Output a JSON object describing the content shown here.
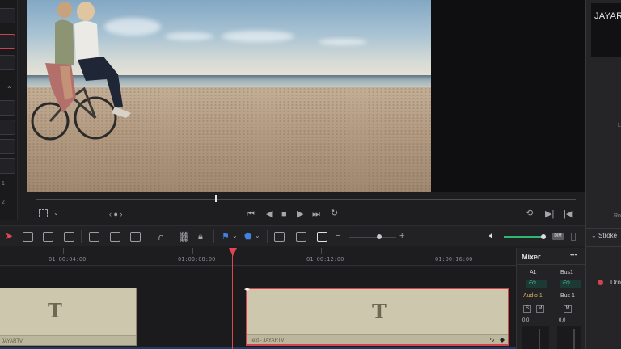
{
  "viewer": {
    "right_title": "JAYAR"
  },
  "transport": {
    "nav_label": "‹ ● ›"
  },
  "timeline": {
    "timecodes": [
      "01:00:04:00",
      "01:00:08:00",
      "01:00:12:00",
      "01:00:16:00"
    ],
    "clips": [
      {
        "glyph": "T",
        "name": "JAYARTV"
      },
      {
        "glyph": "T",
        "name": "Text - JAYARTV"
      }
    ]
  },
  "mixer": {
    "title": "Mixer",
    "menu": "•••",
    "channels": [
      "A1",
      "Bus1"
    ],
    "eq": "EQ",
    "audio_label": "Audio 1",
    "bus_label": "Bus 1",
    "solo": "S",
    "mute": "M",
    "level_left": "0.0",
    "level_right": "0.0"
  },
  "inspector": {
    "stroke_label": "Stroke",
    "drop_label": "Dro",
    "l_label": "L",
    "ro_label": "Ro"
  },
  "left_numbers": [
    "1",
    "2"
  ],
  "colors": {
    "accent_red": "#e04550",
    "clip_fill": "#cdc7ad",
    "volume_green": "#2fb872"
  }
}
